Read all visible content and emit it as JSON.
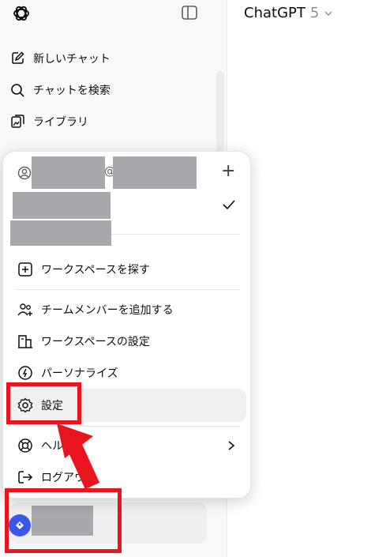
{
  "app": {
    "title": "ChatGPT",
    "version": "5"
  },
  "sidebar": {
    "items": [
      {
        "label": "新しいチャット",
        "icon": "edit-icon"
      },
      {
        "label": "チャットを検索",
        "icon": "search-icon"
      },
      {
        "label": "ライブラリ",
        "icon": "library-icon"
      }
    ]
  },
  "menu": {
    "account_at": "@",
    "add_label": "+",
    "workspace_find": "ワークスペースを探す",
    "add_member": "チームメンバーを追加する",
    "workspace_settings": "ワークスペースの設定",
    "personalize": "パーソナライズ",
    "settings": "設定",
    "help": "ヘルプ",
    "logout": "ログアウト"
  },
  "colors": {
    "annotation": "#e8141e",
    "accent": "#3b57e8",
    "redaction": "#a8a8ad"
  }
}
